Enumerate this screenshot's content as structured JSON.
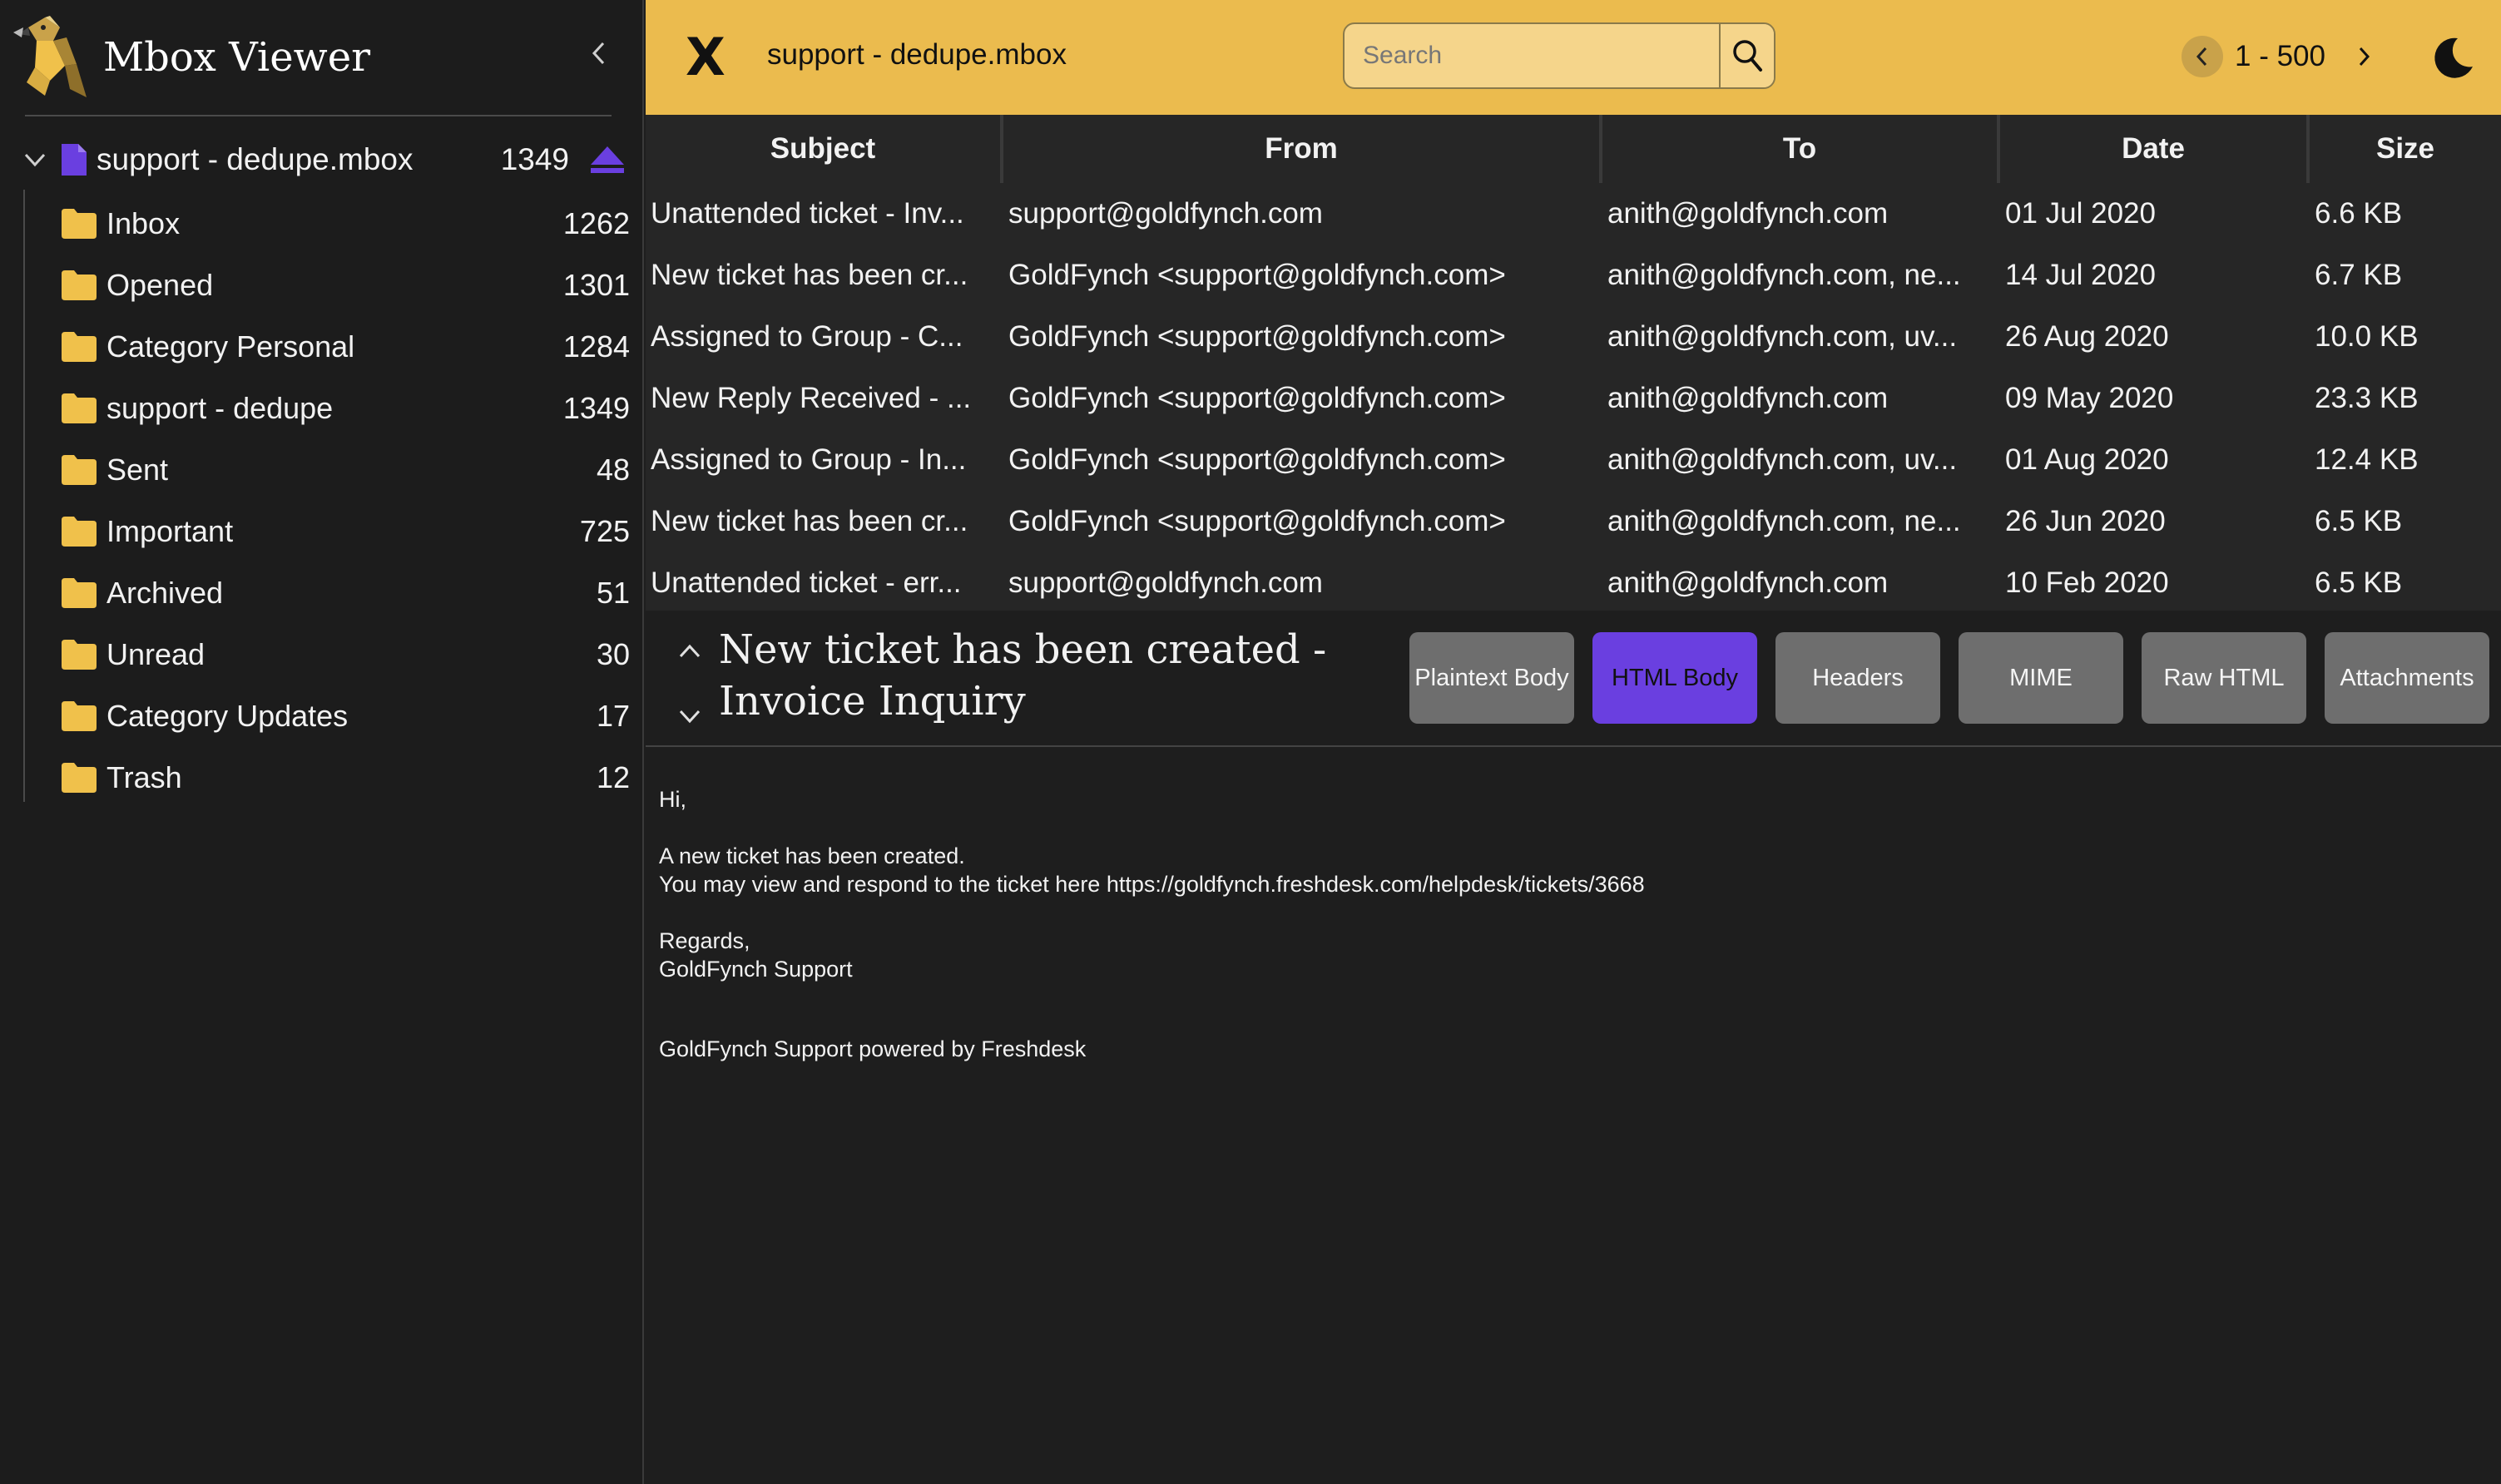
{
  "app": {
    "title": "Mbox Viewer"
  },
  "colors": {
    "accent_yellow": "#ebbb4e",
    "active_purple": "#6a3fe0",
    "folder_yellow": "#f0c14b"
  },
  "sidebar": {
    "mbox": {
      "name": "support - dedupe.mbox",
      "count": "1349"
    },
    "folders": [
      {
        "name": "Inbox",
        "count": "1262"
      },
      {
        "name": "Opened",
        "count": "1301"
      },
      {
        "name": "Category Personal",
        "count": "1284"
      },
      {
        "name": "support - dedupe",
        "count": "1349"
      },
      {
        "name": "Sent",
        "count": "48"
      },
      {
        "name": "Important",
        "count": "725"
      },
      {
        "name": "Archived",
        "count": "51"
      },
      {
        "name": "Unread",
        "count": "30"
      },
      {
        "name": "Category Updates",
        "count": "17"
      },
      {
        "name": "Trash",
        "count": "12"
      }
    ]
  },
  "header": {
    "close_label": "X",
    "file_title": "support - dedupe.mbox",
    "search_placeholder": "Search",
    "page_range": "1 - 500"
  },
  "table": {
    "columns": [
      "Subject",
      "From",
      "To",
      "Date",
      "Size"
    ],
    "rows": [
      {
        "subject": "Unattended ticket - Inv...",
        "from": "support@goldfynch.com",
        "to": "anith@goldfynch.com",
        "date": "01 Jul 2020",
        "size": "6.6 KB"
      },
      {
        "subject": "New ticket has been cr...",
        "from": "GoldFynch <support@goldfynch.com>",
        "to": "anith@goldfynch.com, ne...",
        "date": "14 Jul 2020",
        "size": "6.7 KB"
      },
      {
        "subject": "Assigned to Group - C...",
        "from": "GoldFynch <support@goldfynch.com>",
        "to": "anith@goldfynch.com, uv...",
        "date": "26 Aug 2020",
        "size": "10.0 KB"
      },
      {
        "subject": "New Reply Received - ...",
        "from": "GoldFynch <support@goldfynch.com>",
        "to": "anith@goldfynch.com",
        "date": "09 May 2020",
        "size": "23.3 KB"
      },
      {
        "subject": "Assigned to Group - In...",
        "from": "GoldFynch <support@goldfynch.com>",
        "to": "anith@goldfynch.com, uv...",
        "date": "01 Aug 2020",
        "size": "12.4 KB"
      },
      {
        "subject": "New ticket has been cr...",
        "from": "GoldFynch <support@goldfynch.com>",
        "to": "anith@goldfynch.com, ne...",
        "date": "26 Jun 2020",
        "size": "6.5 KB"
      },
      {
        "subject": "Unattended ticket - err...",
        "from": "support@goldfynch.com",
        "to": "anith@goldfynch.com",
        "date": "10 Feb 2020",
        "size": "6.5 KB"
      }
    ]
  },
  "preview": {
    "subject": "New ticket has been created - Invoice Inquiry",
    "tabs": [
      "Plaintext Body",
      "HTML Body",
      "Headers",
      "MIME",
      "Raw HTML",
      "Attachments"
    ],
    "active_tab": "HTML Body",
    "body": {
      "greeting": "Hi,",
      "line1": "A new ticket has been created.",
      "line2": "You may view and respond to the ticket here https://goldfynch.freshdesk.com/helpdesk/tickets/3668",
      "regards": "Regards,",
      "signature": "GoldFynch Support",
      "footer": "GoldFynch Support powered by Freshdesk"
    }
  }
}
